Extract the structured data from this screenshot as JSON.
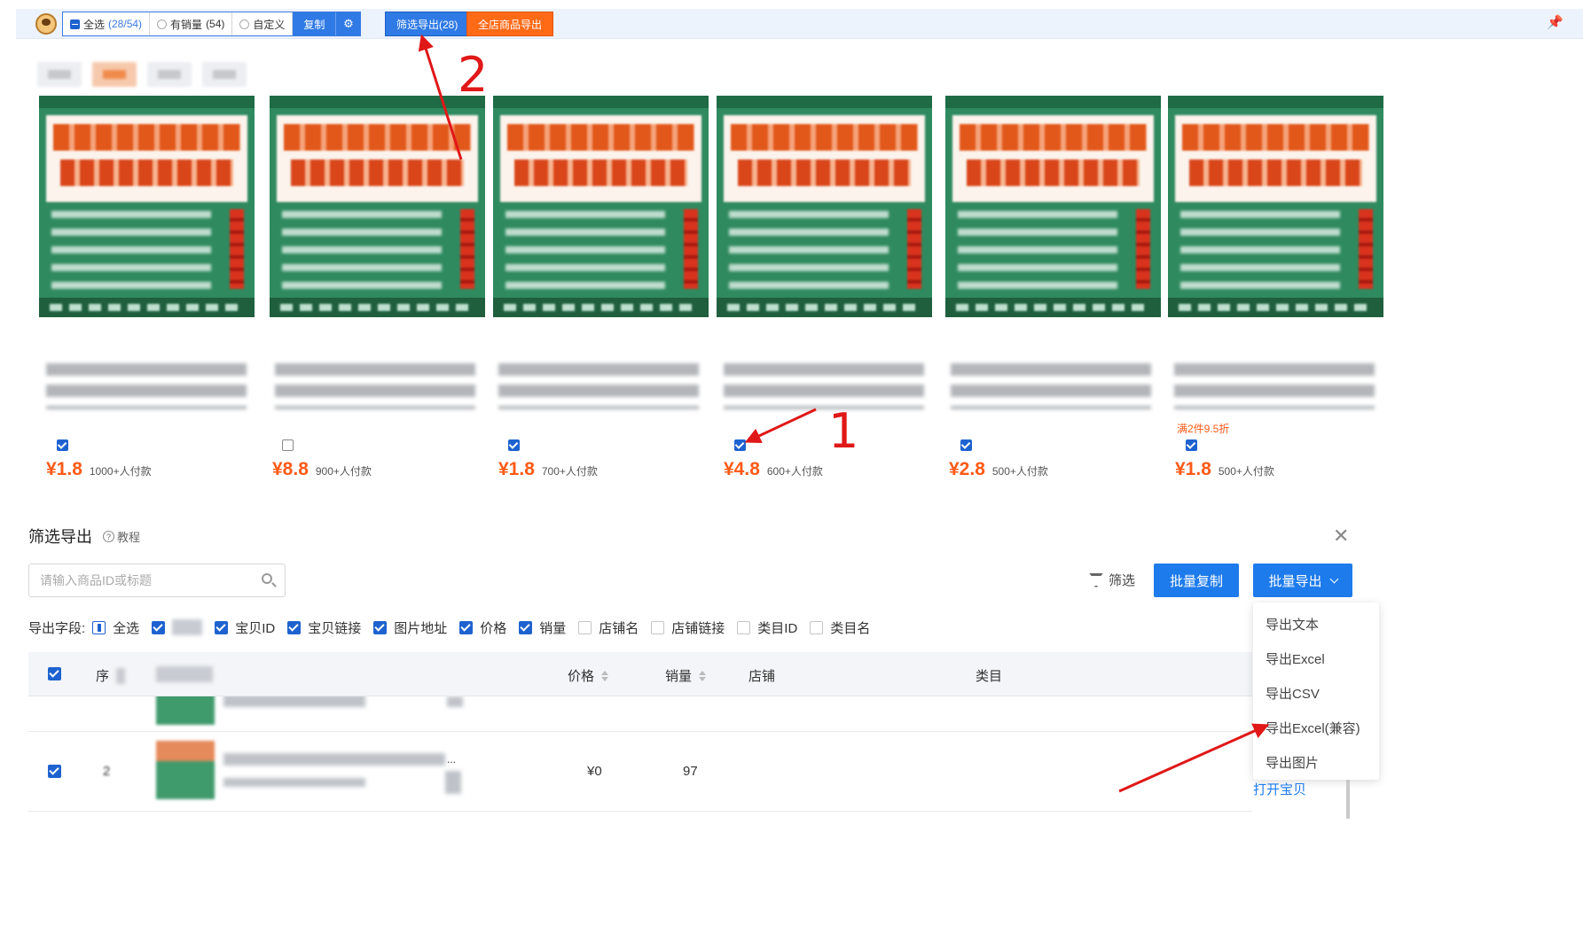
{
  "toolbar": {
    "select_all": "全选",
    "select_all_count": "(28/54)",
    "has_sales": "有销量",
    "has_sales_count": "(54)",
    "custom": "自定义",
    "copy": "复制",
    "filter_export": "筛选导出(28)",
    "store_export": "全店商品导出"
  },
  "products": [
    {
      "price": "¥1.8",
      "sales": "1000+人付款",
      "checked": true
    },
    {
      "price": "¥8.8",
      "sales": "900+人付款",
      "checked": false
    },
    {
      "price": "¥1.8",
      "sales": "700+人付款",
      "checked": true
    },
    {
      "price": "¥4.8",
      "sales": "600+人付款",
      "checked": true
    },
    {
      "price": "¥2.8",
      "sales": "500+人付款",
      "checked": true
    },
    {
      "price": "¥1.8",
      "sales": "500+人付款",
      "checked": true,
      "promo": "满2件9.5折"
    }
  ],
  "annotations": {
    "step1": "1",
    "step2": "2"
  },
  "panel": {
    "title": "筛选导出",
    "tutorial": "教程",
    "search_placeholder": "请输入商品ID或标题",
    "filter": "筛选",
    "batch_copy": "批量复制",
    "batch_export": "批量导出",
    "fields_label": "导出字段:",
    "fields": {
      "all": "全选",
      "id": "宝贝ID",
      "link": "宝贝链接",
      "image": "图片地址",
      "price": "价格",
      "sales": "销量",
      "shop_name": "店铺名",
      "shop_link": "店铺链接",
      "category_id": "类目ID",
      "category_name": "类目名"
    },
    "columns": {
      "index": "序",
      "price": "价格",
      "sales": "销量",
      "shop": "店铺",
      "category": "类目"
    },
    "row": {
      "price": "¥0",
      "sales": "97",
      "partial_text": "...",
      "index_digit": "2"
    },
    "export_menu": [
      "导出文本",
      "导出Excel",
      "导出CSV",
      "导出Excel(兼容)",
      "导出图片"
    ],
    "open_item": "打开宝贝"
  }
}
